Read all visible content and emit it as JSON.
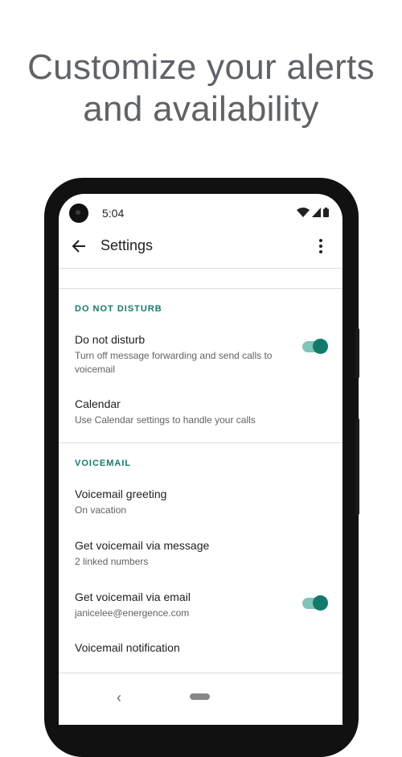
{
  "headline": {
    "line1": "Customize your alerts",
    "line2": "and availability"
  },
  "status_bar": {
    "time": "5:04",
    "icons": [
      "wifi-icon",
      "signal-icon",
      "battery-icon"
    ]
  },
  "app_bar": {
    "title": "Settings",
    "back_icon": "arrow-back-icon",
    "menu_icon": "more-vert-icon"
  },
  "sections": {
    "dnd": {
      "header": "DO NOT DISTURB",
      "do_not_disturb": {
        "title": "Do not disturb",
        "subtitle": "Turn off message forwarding and send calls to voicemail",
        "toggle_on": true
      },
      "calendar": {
        "title": "Calendar",
        "subtitle": "Use Calendar settings to handle your calls"
      }
    },
    "voicemail": {
      "header": "VOICEMAIL",
      "greeting": {
        "title": "Voicemail greeting",
        "subtitle": "On vacation"
      },
      "via_message": {
        "title": "Get voicemail via message",
        "subtitle": "2 linked numbers"
      },
      "via_email": {
        "title": "Get voicemail via email",
        "subtitle": "janicelee@energence.com",
        "toggle_on": true
      },
      "notification": {
        "title": "Voicemail notification"
      }
    }
  },
  "nav": {
    "back_glyph": "‹"
  },
  "colors": {
    "accent": "#137a6b",
    "toggle_track": "#7fc5b8",
    "headline": "#5f6368"
  }
}
